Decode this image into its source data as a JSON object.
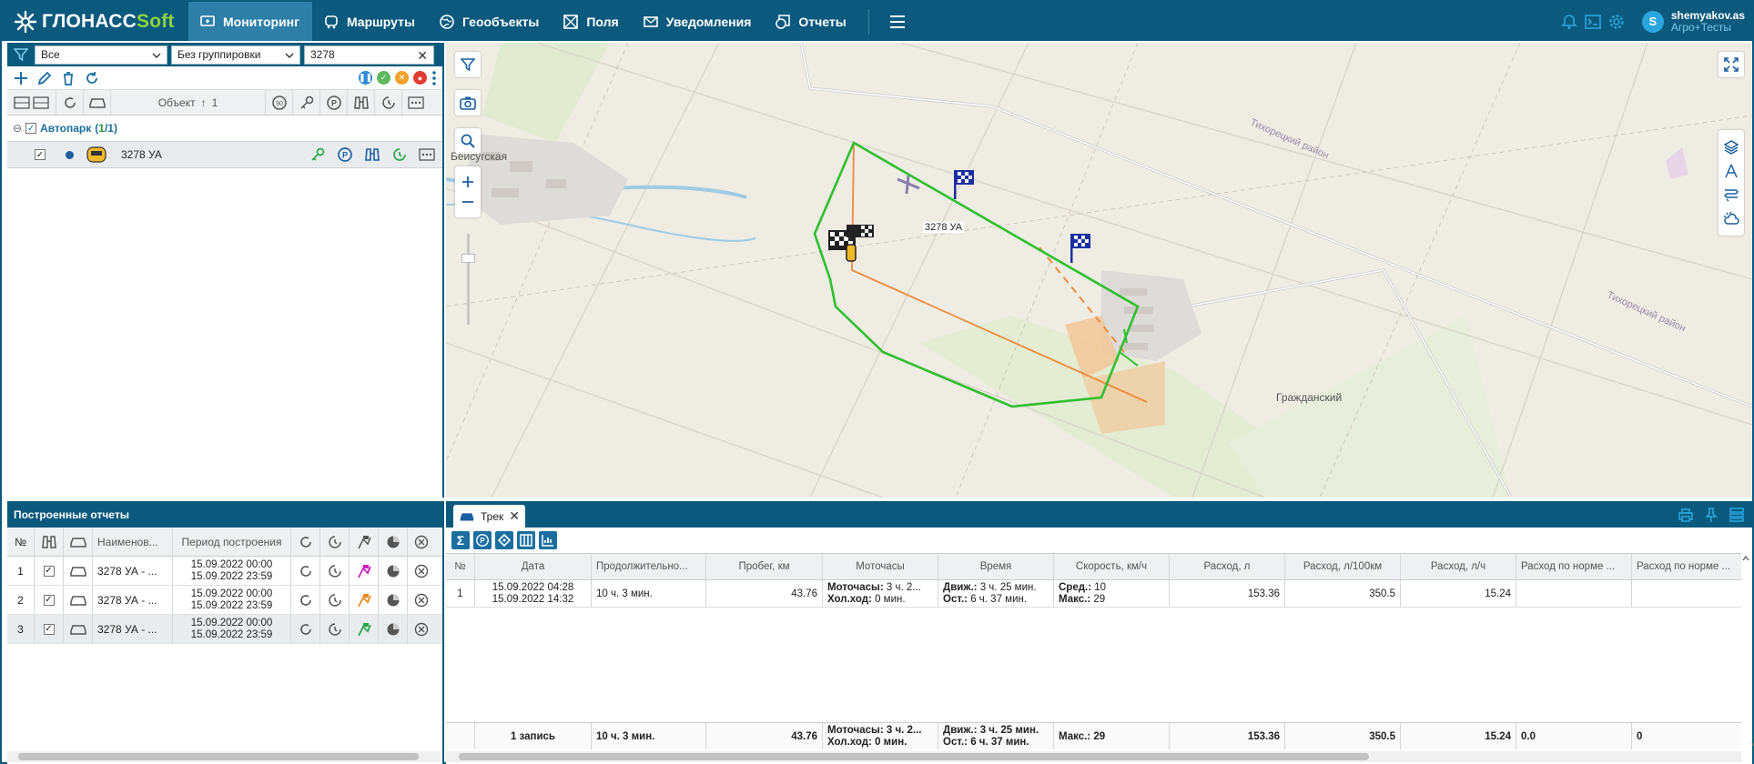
{
  "app": {
    "logo_main": "ГЛОНАСС",
    "logo_accent": "Soft",
    "nav": [
      {
        "label": "Мониторинг",
        "active": true
      },
      {
        "label": "Маршруты"
      },
      {
        "label": "Геообъекты"
      },
      {
        "label": "Поля"
      },
      {
        "label": "Уведомления"
      },
      {
        "label": "Отчеты"
      }
    ],
    "user": {
      "initial": "S",
      "name": "shemyakov.as",
      "org": "Агро+Тесты"
    }
  },
  "left": {
    "filter_status": "Все",
    "filter_group": "Без группировки",
    "search_value": "3278",
    "object_header": "Объект",
    "sort_label": "1",
    "group": {
      "name": "Автопарк",
      "shown": "1",
      "total": "1"
    },
    "object": {
      "name": "3278 УА"
    }
  },
  "map": {
    "labels": {
      "village1": "Бейсугская",
      "village2": "Гражданский",
      "district1": "Тихорецкий район",
      "district2": "Тихорецкий район",
      "vehicle": "3278 УА"
    }
  },
  "reports": {
    "title": "Построенные отчеты",
    "headers": {
      "num": "№",
      "name": "Наименов...",
      "period": "Период построения"
    },
    "rows": [
      {
        "num": "1",
        "name": "3278 УА - ...",
        "from": "15.09.2022 00:00",
        "to": "15.09.2022 23:59",
        "flag_color": "#d01fc0"
      },
      {
        "num": "2",
        "name": "3278 УА - ...",
        "from": "15.09.2022 00:00",
        "to": "15.09.2022 23:59",
        "flag_color": "#f08a1c"
      },
      {
        "num": "3",
        "name": "3278 УА - ...",
        "from": "15.09.2022 00:00",
        "to": "15.09.2022 23:59",
        "flag_color": "#2aa84a"
      }
    ]
  },
  "track": {
    "tab_label": "Трек",
    "headers": {
      "num": "№",
      "date": "Дата",
      "duration": "Продолжительно...",
      "mileage": "Пробег, км",
      "motohours": "Моточасы",
      "time": "Время",
      "speed": "Скорость, км/ч",
      "fuel": "Расход, л",
      "fuel100": "Расход, л/100км",
      "fuelh": "Расход, л/ч",
      "norm1": "Расход по норме ...",
      "norm2": "Расход по норме ..."
    },
    "row": {
      "num": "1",
      "date_from": "15.09.2022 04:28",
      "date_to": "15.09.2022 14:32",
      "duration": "10 ч. 3 мин.",
      "mileage": "43.76",
      "moto_label": "Моточасы:",
      "moto_value": "3 ч. 2...",
      "idle_label": "Хол.ход:",
      "idle_value": "0 мин.",
      "move_label": "Движ.:",
      "move_value": "3 ч. 25 мин.",
      "stop_label": "Ост.:",
      "stop_value": "6 ч. 37 мин.",
      "avg_label": "Сред.:",
      "avg_value": "10",
      "max_label": "Макс.:",
      "max_value": "29",
      "fuel": "153.36",
      "fuel100": "350.5",
      "fuelh": "15.24"
    },
    "total": {
      "label": "1 запись",
      "duration": "10 ч. 3 мин.",
      "mileage": "43.76",
      "moto_label": "Моточасы:",
      "moto_value": "3 ч. 2...",
      "idle_label": "Хол.ход:",
      "idle_value": "0 мин.",
      "move_label": "Движ.:",
      "move_value": "3 ч. 25 мин.",
      "stop_label": "Ост.:",
      "stop_value": "6 ч. 37 мин.",
      "max_label": "Макс.:",
      "max_value": "29",
      "fuel": "153.36",
      "fuel100": "350.5",
      "fuelh": "15.24",
      "norm1": "0.0",
      "norm2": "0"
    }
  },
  "colors": {
    "brand": "#0b5a7e",
    "active_nav": "#2d7fa8",
    "accent_green": "#8fd13f",
    "track_green": "#2fbf2f",
    "track_orange": "#f08a3c"
  }
}
